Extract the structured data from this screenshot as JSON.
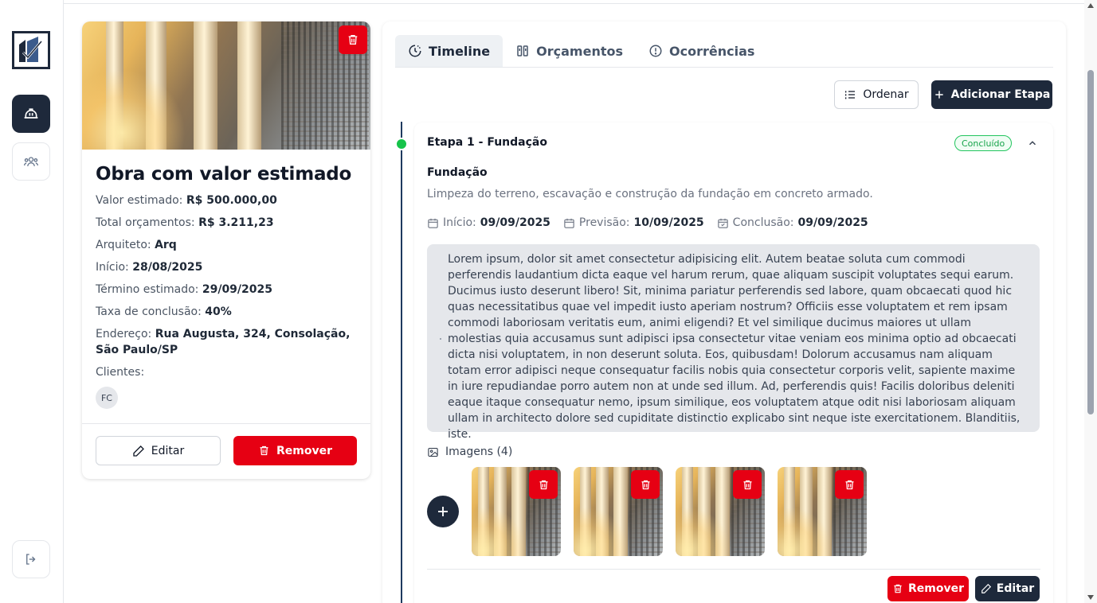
{
  "sidebar": {
    "logo_icon": "company-logo",
    "items": [
      {
        "icon": "hard-hat-icon",
        "active": true
      },
      {
        "icon": "users-icon",
        "active": false
      }
    ],
    "logout_icon": "logout-icon"
  },
  "project": {
    "title": "Obra com valor estimado",
    "fields": [
      {
        "label": "Valor estimado: ",
        "value": "R$ 500.000,00"
      },
      {
        "label": "Total orçamentos: ",
        "value": "R$ 3.211,23"
      },
      {
        "label": "Arquiteto: ",
        "value": "Arq"
      },
      {
        "label": "Início: ",
        "value": "28/08/2025"
      },
      {
        "label": "Término estimado: ",
        "value": "29/09/2025"
      },
      {
        "label": "Taxa de conclusão: ",
        "value": "40%"
      },
      {
        "label": "Endereço: ",
        "value": "Rua Augusta, 324, Consolação, São Paulo/SP"
      }
    ],
    "clients_label": "Clientes:",
    "clients": [
      "FC"
    ],
    "edit_label": "Editar",
    "remove_label": "Remover"
  },
  "tabs": [
    {
      "label": "Timeline",
      "icon": "clock-icon",
      "active": true
    },
    {
      "label": "Orçamentos",
      "icon": "budget-icon",
      "active": false
    },
    {
      "label": "Ocorrências",
      "icon": "alert-circle-icon",
      "active": false
    }
  ],
  "toolbar": {
    "sort_label": "Ordenar",
    "add_stage_label": "Adicionar Etapa"
  },
  "stage": {
    "title": "Etapa 1 - Fundação",
    "status": "Concluído",
    "subtitle": "Fundação",
    "description": "Limpeza do terreno, escavação e construção da fundação em concreto armado.",
    "start_label": "Início:",
    "start_value": "09/09/2025",
    "forecast_label": "Previsão:",
    "forecast_value": "10/09/2025",
    "done_label": "Conclusão:",
    "done_value": "09/09/2025",
    "notes": "Lorem ipsum, dolor sit amet consectetur adipisicing elit. Autem beatae soluta cum commodi perferendis laudantium dicta eaque vel harum rerum, quae aliquam suscipit voluptates sequi earum. Ducimus iusto deserunt libero! Sit, minima pariatur perferendis sed labore, quam obcaecati quod hic quas necessitatibus quae vel impedit iusto aperiam nostrum? Officiis esse voluptatem et rem ipsam commodi laboriosam veritatis eum, animi eligendi? Et vel similique ducimus maiores ut ullam molestias quia accusamus sunt adipisci ipsa consectetur vitae veniam eos minima optio ad obcaecati dicta nisi voluptatem, in non deserunt soluta. Eos, quibusdam! Dolorum accusamus nam aliquam totam error adipisci neque consequatur facilis nobis quia consectetur corporis velit, sapiente maxime in iure repudiandae porro autem non at unde sed illum. Ad, perferendis quis! Facilis doloribus deleniti eaque itaque consequatur nemo, ipsum similique, eos voluptatem atque odit nisi laboriosam aliquam ullam in architecto dolore sed cupiditate distinctio explicabo sint neque iste exercitationem. Blanditiis, iste.",
    "images_label": "Imagens (4)",
    "image_count": 4,
    "remove_label": "Remover",
    "edit_label": "Editar"
  },
  "colors": {
    "primary": "#1e293b",
    "danger": "#e60013",
    "success": "#16a34a"
  }
}
